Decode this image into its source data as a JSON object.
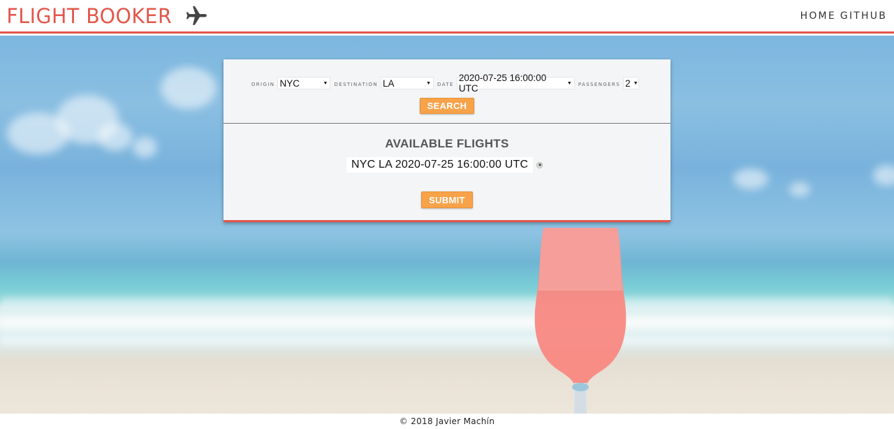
{
  "header": {
    "brand": "FLIGHT BOOKER",
    "brand_icon": "airplane-icon",
    "brand_color": "#e2574c",
    "nav": [
      {
        "label": "HOME"
      },
      {
        "label": "GITHUB"
      }
    ]
  },
  "search": {
    "origin_label": "ORIGIN",
    "origin_value": "NYC",
    "destination_label": "DESTINATION",
    "destination_value": "LA",
    "date_label": "DATE",
    "date_value": "2020-07-25 16:00:00 UTC",
    "passengers_label": "PASSENGERS",
    "passengers_value": "2",
    "search_button": "SEARCH"
  },
  "results": {
    "title": "AVAILABLE FLIGHTS",
    "flights": [
      {
        "label": "NYC LA 2020-07-25 16:00:00 UTC",
        "selected": false
      }
    ],
    "submit_button": "SUBMIT"
  },
  "footer": {
    "copyright": "© 2018 Javier Machín"
  },
  "colors": {
    "accent": "#e2574c",
    "button": "#f8a24a"
  }
}
